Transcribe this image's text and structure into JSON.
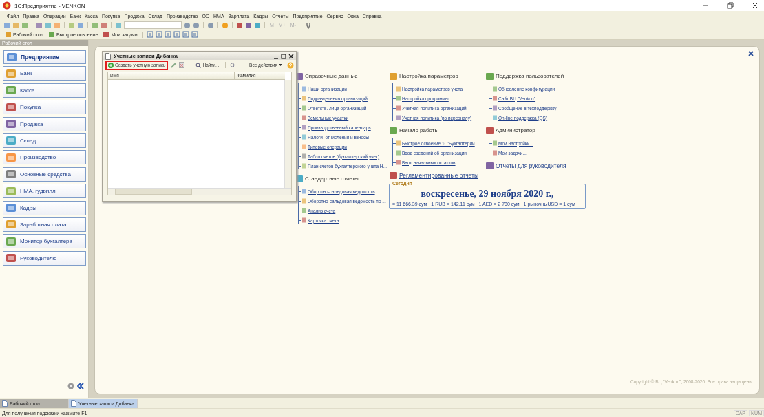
{
  "window": {
    "title": "1С:Предприятие - VENKON"
  },
  "menu": [
    "Файл",
    "Правка",
    "Операции",
    "Банк",
    "Касса",
    "Покупка",
    "Продажа",
    "Склад",
    "Производство",
    "ОС",
    "НМА",
    "Зарплата",
    "Кадры",
    "Отчеты",
    "Предприятие",
    "Сервис",
    "Окна",
    "Справка"
  ],
  "toolbar": {
    "memory_buttons": [
      {
        "label": "M",
        "disabled": true
      },
      {
        "label": "M+",
        "disabled": true
      },
      {
        "label": "M-",
        "disabled": true
      }
    ]
  },
  "panel_bar": [
    {
      "label": "Рабочий стол"
    },
    {
      "label": "Быстрое освоение"
    },
    {
      "label": "Мои задачи"
    }
  ],
  "sidebar": {
    "title": "Рабочий стол",
    "items": [
      {
        "label": "Предприятие",
        "selected": true
      },
      {
        "label": "Банк",
        "selected": false
      },
      {
        "label": "Касса",
        "selected": false
      },
      {
        "label": "Покупка",
        "selected": false
      },
      {
        "label": "Продажа",
        "selected": false
      },
      {
        "label": "Склад",
        "selected": false
      },
      {
        "label": "Производство",
        "selected": false
      },
      {
        "label": "Основные средства",
        "selected": false
      },
      {
        "label": "НМА, гудвилл",
        "selected": false
      },
      {
        "label": "Кадры",
        "selected": false
      },
      {
        "label": "Заработная плата",
        "selected": false
      },
      {
        "label": "Монитор бухгалтера",
        "selected": false
      },
      {
        "label": "Руководителю",
        "selected": false
      }
    ]
  },
  "desktop": {
    "columns": [
      [
        {
          "title": "Справочные данные",
          "kind": "group",
          "items": [
            "Наши организации",
            "Подразделения организаций",
            "Ответств. лица организаций",
            "Земельные участки",
            "Производственный календарь",
            "Налоги, отчисления и взносы",
            "Типовые операции",
            "Табло счетов (бухгалтерский учет)",
            "План счетов бухгалтерского учета Н..."
          ]
        },
        {
          "title": "Стандартные отчеты",
          "kind": "group",
          "items": [
            "Оборотно-сальдовая ведомость",
            "Оборотно-сальдовая ведомость по ...",
            "Анализ счета",
            "Карточка счета"
          ]
        }
      ],
      [
        {
          "title": "Настройка параметров",
          "kind": "group",
          "items": [
            "Настройка параметров учета",
            "Настройка программы",
            "Учетная политика организаций",
            "Учетная политика (по персоналу)"
          ]
        },
        {
          "title": "Начало работы",
          "kind": "group",
          "items": [
            "Быстрое освоение 1С:Бухгалтерии",
            "Ввод сведений об организации",
            "Ввод начальных остатков"
          ]
        },
        {
          "title": "Регламентированные отчеты",
          "kind": "link"
        }
      ],
      [
        {
          "title": "Поддержка пользователей",
          "kind": "group",
          "items": [
            "Обновление конфигурации",
            "Сайт ВЦ \"Venkon\"",
            "Сообщение в техподдержку",
            "On-line поддержка (QS)"
          ]
        },
        {
          "title": "Администратор",
          "kind": "group",
          "items": [
            "Мои настройки...",
            "Мои задачи..."
          ]
        },
        {
          "title": "Отчеты для руководителя",
          "kind": "link"
        }
      ]
    ],
    "today": {
      "legend": "Сегодня",
      "date": "воскресенье, 29 ноября 2020 г.,",
      "rates": [
        "= 11 666,39 сум",
        "1 RUB = 142,11 сум",
        "1 AED = 2 780 сум",
        "1 рыночныUSD = 1 сум"
      ]
    },
    "copyright": "Copyright © ВЦ \"Venkon\", 2008-2020. Все права защищены"
  },
  "dialog": {
    "title": "Учетные записи Дибанка",
    "create_button": {
      "label": "Создать учетную запись",
      "highlighted": true
    },
    "find_button": "Найти...",
    "actions_menu": "Все действия",
    "table": {
      "columns": [
        "Имя",
        "Фамилия"
      ]
    }
  },
  "taskbar": [
    {
      "label": "Рабочий стол",
      "selected": false
    },
    {
      "label": "Учетные записи Дибанка",
      "selected": true
    }
  ],
  "status_bar": {
    "hint": "Для получения подсказки нажмите F1",
    "indicators": [
      "CAP",
      "NUM"
    ]
  }
}
